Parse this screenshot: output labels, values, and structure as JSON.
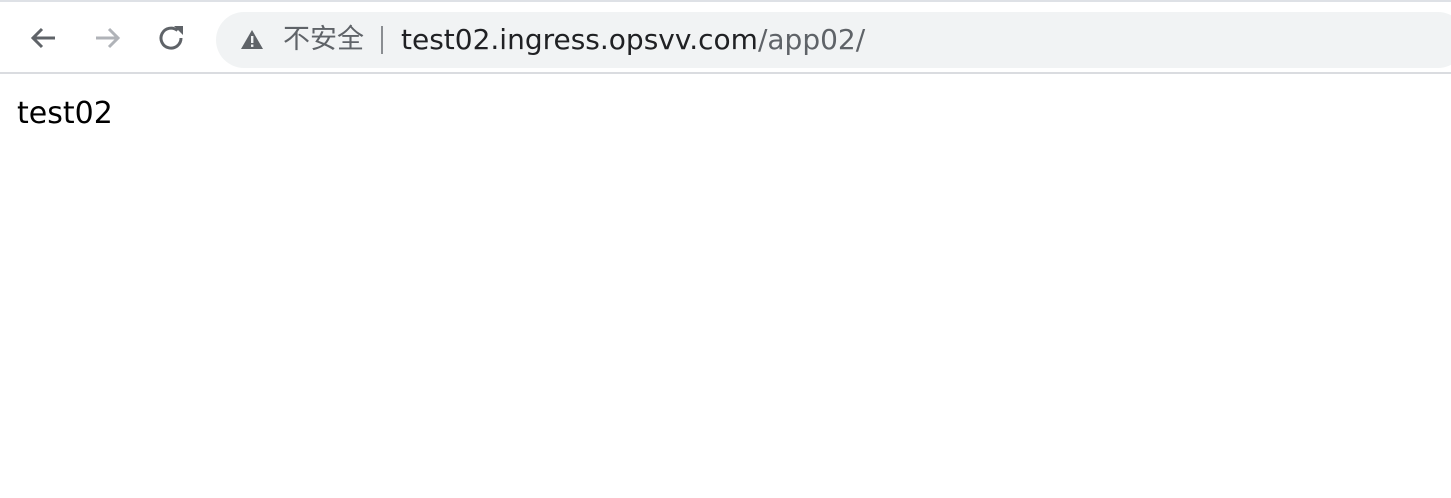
{
  "toolbar": {
    "back_icon": "arrow-left-icon",
    "forward_icon": "arrow-right-icon",
    "reload_icon": "reload-icon",
    "forward_disabled": true
  },
  "omnibox": {
    "security_icon": "warning-triangle-icon",
    "security_label": "不安全",
    "url_host": "test02.ingress.opsvv.com",
    "url_path": "/app02/"
  },
  "page": {
    "body_text": "test02"
  },
  "colors": {
    "toolbar_bg": "#ffffff",
    "omnibox_bg": "#f1f3f4",
    "icon_active": "#5f6368",
    "icon_disabled": "#b0b3b8",
    "url_host": "#202124",
    "url_path": "#5f6368"
  }
}
